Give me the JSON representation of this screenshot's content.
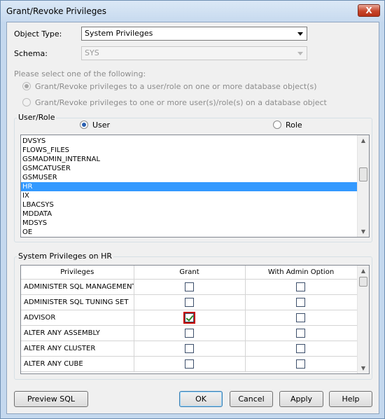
{
  "window": {
    "title": "Grant/Revoke Privileges",
    "close_symbol": "X"
  },
  "object_type": {
    "label": "Object Type:",
    "value": "System Privileges"
  },
  "schema": {
    "label": "Schema:",
    "value": "SYS"
  },
  "prompt": "Please select one of the following:",
  "radio_options": [
    "Grant/Revoke privileges to a user/role on one or more database object(s)",
    "Grant/Revoke privileges to one or more user(s)/role(s) on a database object"
  ],
  "user_role": {
    "group_title": "User/Role",
    "user_label": "User",
    "role_label": "Role",
    "items": [
      "DVSYS",
      "FLOWS_FILES",
      "GSMADMIN_INTERNAL",
      "GSMCATUSER",
      "GSMUSER",
      "HR",
      "IX",
      "LBACSYS",
      "MDDATA",
      "MDSYS",
      "OE"
    ],
    "selected": "HR"
  },
  "privileges": {
    "group_title": "System Privileges on HR",
    "columns": [
      "Privileges",
      "Grant",
      "With Admin Option"
    ],
    "rows": [
      {
        "name": "ADMINISTER SQL MANAGEMENT",
        "grant": false,
        "admin": false
      },
      {
        "name": "ADMINISTER SQL TUNING SET",
        "grant": false,
        "admin": false
      },
      {
        "name": "ADVISOR",
        "grant": true,
        "admin": false
      },
      {
        "name": "ALTER ANY ASSEMBLY",
        "grant": false,
        "admin": false
      },
      {
        "name": "ALTER ANY CLUSTER",
        "grant": false,
        "admin": false
      },
      {
        "name": "ALTER ANY CUBE",
        "grant": false,
        "admin": false
      }
    ]
  },
  "buttons": {
    "preview_sql": "Preview SQL",
    "ok": "OK",
    "cancel": "Cancel",
    "apply": "Apply",
    "help": "Help"
  },
  "colors": {
    "selection": "#3399ff",
    "check_highlight": "#c80000",
    "check_mark": "#2c8a2c"
  }
}
